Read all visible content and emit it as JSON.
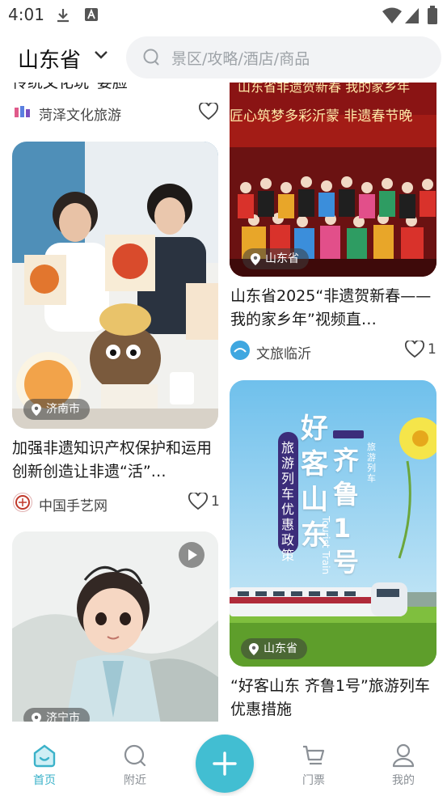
{
  "status_bar": {
    "time": "4:01"
  },
  "header": {
    "province": "山东省",
    "search_placeholder": "景区/攻略/酒店/商品"
  },
  "feed": {
    "left": [
      {
        "title": "传统文化玩“要脸”",
        "author": "菏泽文化旅游",
        "likes": ""
      },
      {
        "location": "济南市",
        "title": "加强非遗知识产权保护和运用 创新创造让非遗“活”…",
        "author": "中国手艺网",
        "likes": "1"
      },
      {
        "location": "济宁市"
      }
    ],
    "right": [
      {
        "location": "山东省",
        "title": "山东省2025“非遗贺新春——我的家乡年”视频直…",
        "author": "文旅临沂",
        "likes": "1",
        "image_text": {
          "banner": "山东省非遗贺新春 我的家乡年",
          "slogan": "匠心筑梦多彩沂蒙 非遗春节晚"
        }
      },
      {
        "location": "山东省",
        "title": "“好客山东 齐鲁1号”旅游列车优惠措施",
        "image_text": {
          "poster_line1": "好客山东",
          "poster_line2": "齐鲁1号",
          "tag": "旅游列车优惠政策",
          "sub": "旅游列车",
          "train_en": "Tourist Train"
        }
      }
    ]
  },
  "bottom_nav": {
    "items": [
      {
        "label": "首页"
      },
      {
        "label": "附近"
      },
      {
        "label": "门票"
      },
      {
        "label": "我的"
      }
    ]
  },
  "colors": {
    "accent": "#42bed2",
    "active": "#3bb2c9"
  }
}
